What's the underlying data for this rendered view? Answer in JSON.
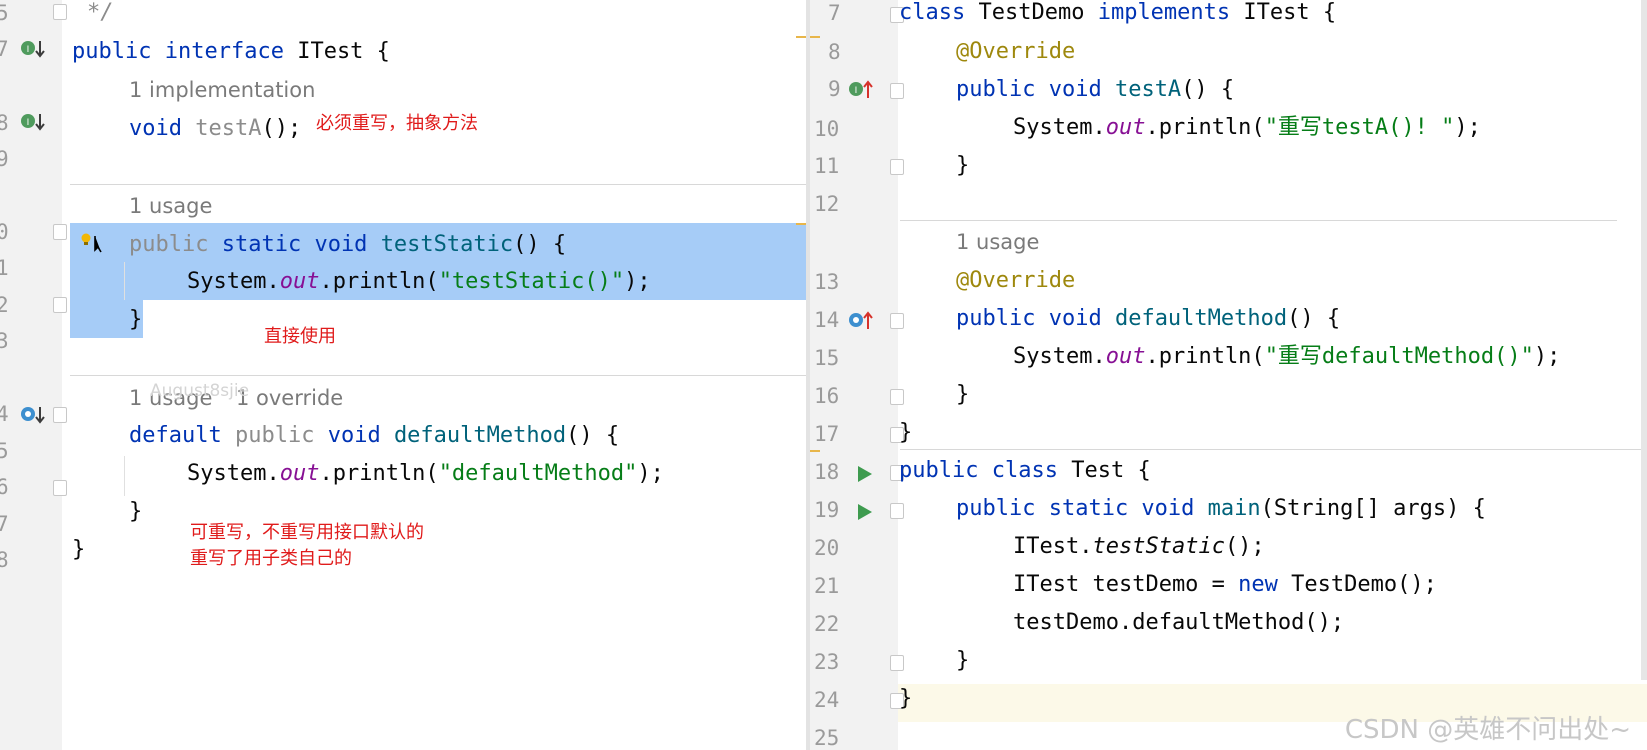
{
  "left": {
    "line_numbers": [
      "5",
      "7",
      "",
      "8",
      "9",
      "",
      "0",
      "1",
      "2",
      "3",
      "",
      "4",
      "5",
      "6",
      "7",
      "8"
    ],
    "code": {
      "comment": "*/",
      "iface_public": "public",
      "iface_interface": "interface",
      "iface_name": "ITest {",
      "hint_impl": "1 implementation",
      "testA_void": "void",
      "testA_name": "testA",
      "testA_rest": "();",
      "hint_usage1": "1 usage",
      "static_public": "public",
      "static_kw": "static void",
      "static_name": "testStatic",
      "static_rest": "() {",
      "sysout1_a": "System.",
      "sysout1_out": "out",
      "sysout1_b": ".println(",
      "sysout1_str": "\"testStatic()\"",
      "sysout1_c": ");",
      "close1": "}",
      "hint_usage2": "1 usage",
      "hint_override": "1 override",
      "default_kw": "default",
      "default_public": "public",
      "default_void": "void",
      "default_name": "defaultMethod",
      "default_rest": "() {",
      "sysout2_a": "System.",
      "sysout2_out": "out",
      "sysout2_b": ".println(",
      "sysout2_str": "\"defaultMethod\"",
      "sysout2_c": ");",
      "close2": "}",
      "close3": "}"
    },
    "notes": {
      "abstract": "必须重写，抽象方法",
      "direct_use": "直接使用",
      "overridable": "可重写，不重写用接口默认的\n重写了用子类自己的"
    },
    "author_tag": "August8sjie"
  },
  "right": {
    "line_numbers": [
      "7",
      "8",
      "9",
      "10",
      "11",
      "12",
      "",
      "13",
      "14",
      "15",
      "16",
      "17",
      "18",
      "19",
      "20",
      "21",
      "22",
      "23",
      "24",
      "25"
    ],
    "code": {
      "class_kw": "class",
      "class_name": "TestDemo",
      "implements_kw": "implements",
      "iface": "ITest {",
      "override1": "@Override",
      "testA_public": "public void",
      "testA_name": "testA",
      "testA_rest": "() {",
      "println1_a": "System.",
      "println1_out": "out",
      "println1_b": ".println(",
      "println1_str": "\"重写testA()! \"",
      "println1_c": ");",
      "close1": "}",
      "hint_usage": "1 usage",
      "override2": "@Override",
      "dm_public": "public void",
      "dm_name": "defaultMethod",
      "dm_rest": "() {",
      "println2_a": "System.",
      "println2_out": "out",
      "println2_b": ".println(",
      "println2_str": "\"重写defaultMethod()\"",
      "println2_c": ");",
      "close2": "}",
      "close3": "}",
      "test_public": "public",
      "test_class": "class",
      "test_name": "Test {",
      "main_kw": "public static void",
      "main_name": "main",
      "main_rest": "(String[] args) {",
      "call_static_a": "ITest.",
      "call_static_b": "testStatic",
      "call_static_c": "();",
      "new_a": "ITest testDemo = ",
      "new_kw": "new",
      "new_b": " TestDemo();",
      "call_default": "testDemo.defaultMethod();",
      "close4": "}",
      "close5": "}"
    }
  },
  "watermark": "CSDN @英雄不问出处~",
  "colors": {
    "keyword": "#0033b3",
    "string": "#067d17",
    "function": "#00627a",
    "field": "#871094",
    "annotation": "#9e880d",
    "selection": "#a6ccf7",
    "note": "#e01b1b"
  },
  "icons": [
    "implemented-down-arrow-icon",
    "override-up-arrow-icon",
    "run-icon",
    "bulb-icon",
    "fold-icon"
  ]
}
